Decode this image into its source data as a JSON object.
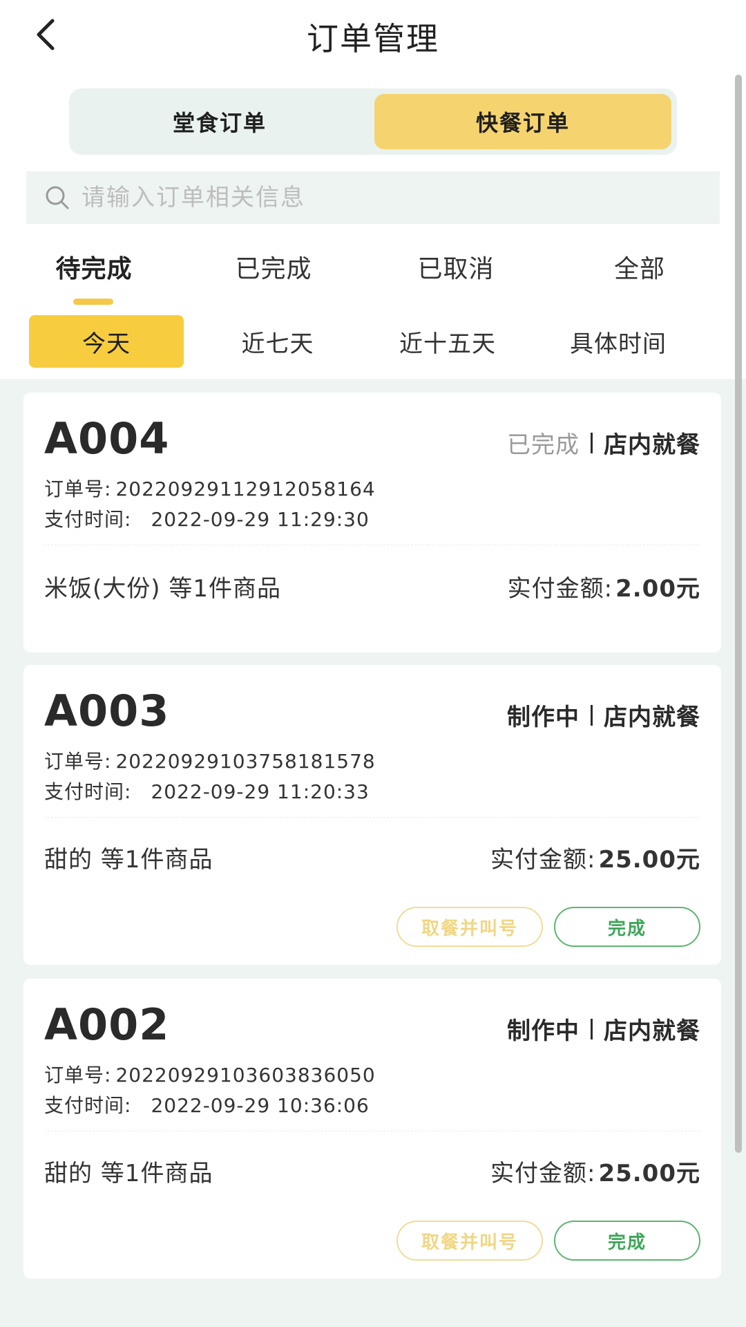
{
  "header": {
    "title": "订单管理"
  },
  "order_type_tabs": {
    "dine_in": "堂食订单",
    "fast_food": "快餐订单",
    "active": "fast_food"
  },
  "search": {
    "placeholder": "请输入订单相关信息",
    "value": ""
  },
  "status_tabs": [
    {
      "label": "待完成",
      "active": true
    },
    {
      "label": "已完成",
      "active": false
    },
    {
      "label": "已取消",
      "active": false
    },
    {
      "label": "全部",
      "active": false
    }
  ],
  "time_filters": [
    {
      "label": "今天",
      "active": true
    },
    {
      "label": "近七天",
      "active": false
    },
    {
      "label": "近十五天",
      "active": false
    },
    {
      "label": "具体时间",
      "active": false
    }
  ],
  "labels": {
    "order_number": "订单号:",
    "pay_time": "支付时间:",
    "paid_amount": "实付金额:"
  },
  "orders": [
    {
      "code": "A004",
      "status": "已完成",
      "dine_type": "店内就餐",
      "order_number": "20220929112912058164",
      "pay_time": "2022-09-29 11:29:30",
      "items": "米饭(大份) 等1件商品",
      "amount": "2.00元",
      "actions": []
    },
    {
      "code": "A003",
      "status": "制作中",
      "dine_type": "店内就餐",
      "order_number": "20220929103758181578",
      "pay_time": "2022-09-29 11:20:33",
      "items": "甜的 等1件商品",
      "amount": "25.00元",
      "actions": [
        "取餐并叫号",
        "完成"
      ]
    },
    {
      "code": "A002",
      "status": "制作中",
      "dine_type": "店内就餐",
      "order_number": "20220929103603836050",
      "pay_time": "2022-09-29 10:36:06",
      "items": "甜的 等1件商品",
      "amount": "25.00元",
      "actions": [
        "取餐并叫号",
        "完成"
      ]
    }
  ],
  "colors": {
    "accent_yellow": "#f7cd3f",
    "segment_active": "#f5d36f",
    "complete_green": "#3fa55a",
    "call_button_border": "#f0dc97",
    "done_status_gray": "#9a9a9a"
  },
  "icons": {
    "back": "chevron-left-icon",
    "search": "search-icon"
  }
}
